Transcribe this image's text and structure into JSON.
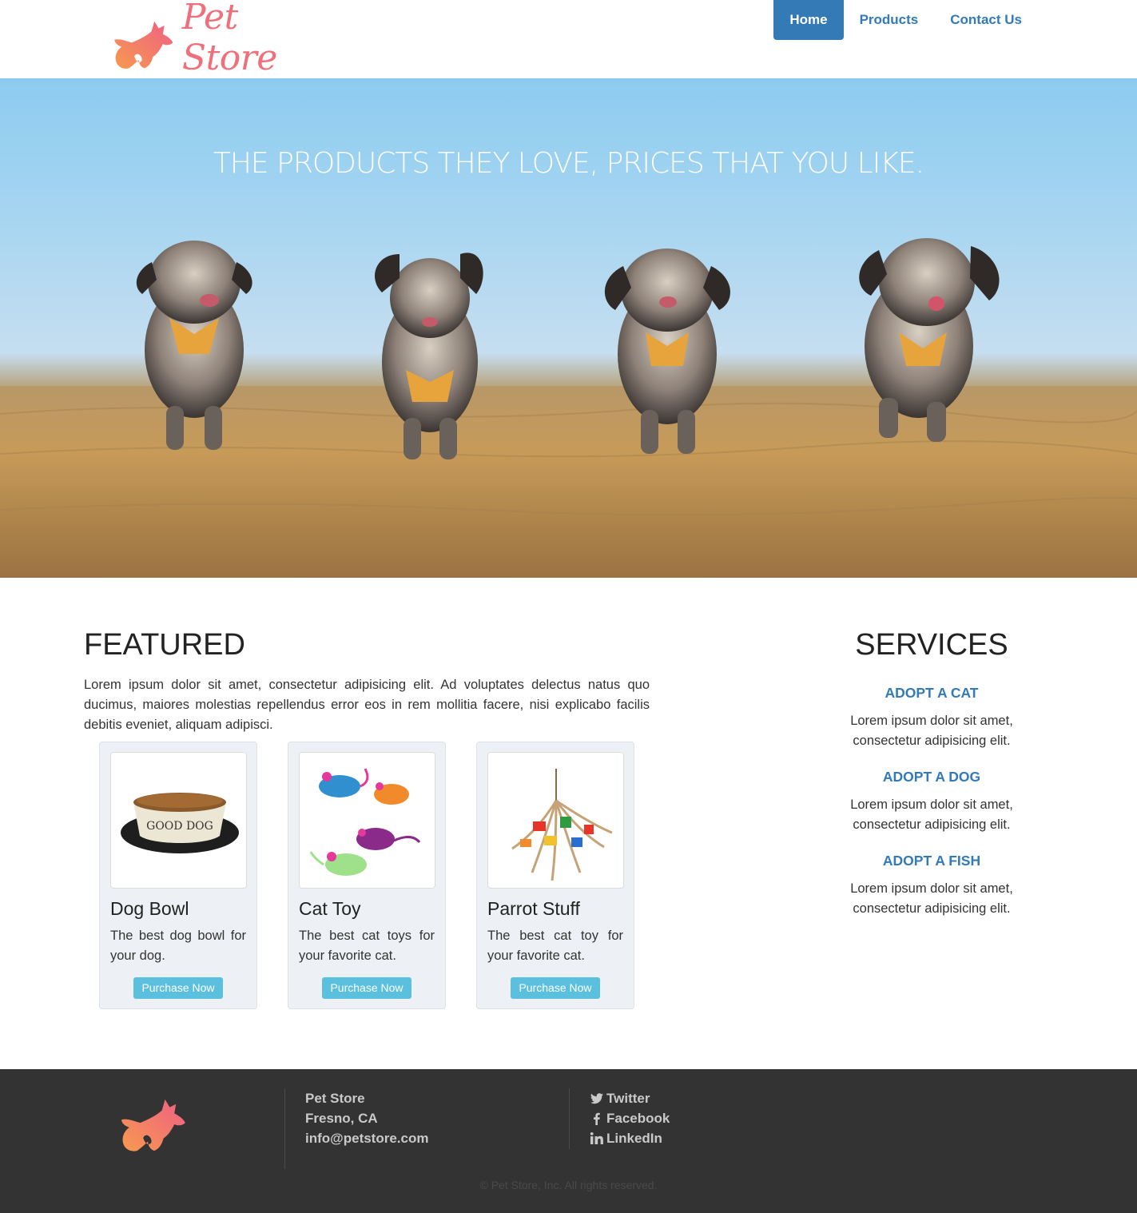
{
  "header": {
    "logo_text": "Pet Store",
    "nav": [
      {
        "label": "Home",
        "active": true
      },
      {
        "label": "Products",
        "active": false
      },
      {
        "label": "Contact Us",
        "active": false
      }
    ]
  },
  "hero": {
    "title": "THE PRODUCTS THEY LOVE, PRICES THAT YOU LIKE."
  },
  "featured": {
    "title": "FEATURED",
    "text": "Lorem ipsum dolor sit amet, consectetur adipisicing elit. Ad voluptates delectus natus quo ducimus, maiores molestias repellendus error eos in rem mollitia facere, nisi explicabo facilis debitis eveniet, aliquam adipisci.",
    "products": [
      {
        "name": "Dog Bowl",
        "description": "The best dog bowl for your dog.",
        "button": "Purchase Now",
        "bowl_label": "GOOD DOG"
      },
      {
        "name": "Cat Toy",
        "description": "The best cat toys for your favorite cat.",
        "button": "Purchase Now"
      },
      {
        "name": "Parrot Stuff",
        "description": "The best cat toy for your favorite cat.",
        "button": "Purchase Now"
      }
    ]
  },
  "services": {
    "title": "SERVICES",
    "items": [
      {
        "heading": "ADOPT A CAT",
        "text": "Lorem ipsum dolor sit amet, consectetur adipisicing elit."
      },
      {
        "heading": "ADOPT A DOG",
        "text": "Lorem ipsum dolor sit amet, consectetur adipisicing elit."
      },
      {
        "heading": "ADOPT A FISH",
        "text": "Lorem ipsum dolor sit amet, consectetur adipisicing elit."
      }
    ]
  },
  "footer": {
    "address": [
      "Pet Store",
      "Fresno, CA",
      "info@petstore.com"
    ],
    "social": [
      {
        "icon": "twitter-icon",
        "label": "Twitter"
      },
      {
        "icon": "facebook-icon",
        "label": "Facebook"
      },
      {
        "icon": "linkedin-icon",
        "label": "LinkedIn"
      }
    ],
    "copyright": "© Pet Store, Inc. All rights reserved."
  },
  "colors": {
    "primary": "#337ab7",
    "button_info": "#5bc0de",
    "logo_pink": "#ef6f7a",
    "logo_orange": "#f79a4e",
    "footer_bg": "#333333"
  }
}
